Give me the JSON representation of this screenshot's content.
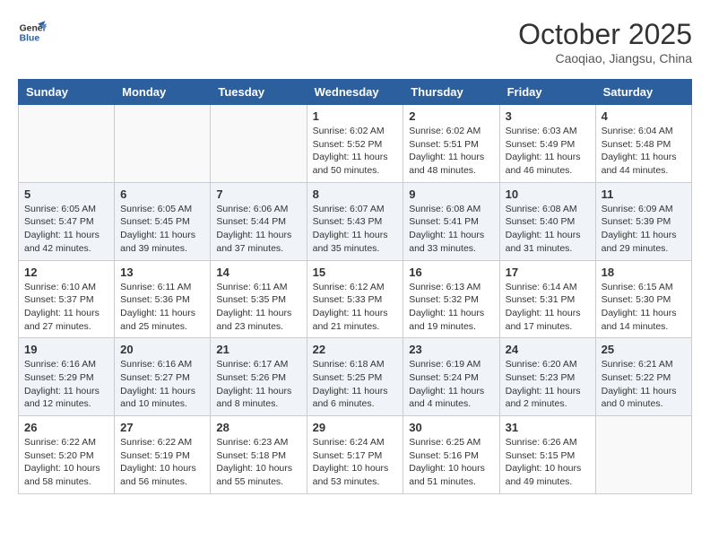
{
  "header": {
    "logo_line1": "General",
    "logo_line2": "Blue",
    "month": "October 2025",
    "location": "Caoqiao, Jiangsu, China"
  },
  "weekdays": [
    "Sunday",
    "Monday",
    "Tuesday",
    "Wednesday",
    "Thursday",
    "Friday",
    "Saturday"
  ],
  "weeks": [
    [
      {
        "day": "",
        "info": ""
      },
      {
        "day": "",
        "info": ""
      },
      {
        "day": "",
        "info": ""
      },
      {
        "day": "1",
        "info": "Sunrise: 6:02 AM\nSunset: 5:52 PM\nDaylight: 11 hours\nand 50 minutes."
      },
      {
        "day": "2",
        "info": "Sunrise: 6:02 AM\nSunset: 5:51 PM\nDaylight: 11 hours\nand 48 minutes."
      },
      {
        "day": "3",
        "info": "Sunrise: 6:03 AM\nSunset: 5:49 PM\nDaylight: 11 hours\nand 46 minutes."
      },
      {
        "day": "4",
        "info": "Sunrise: 6:04 AM\nSunset: 5:48 PM\nDaylight: 11 hours\nand 44 minutes."
      }
    ],
    [
      {
        "day": "5",
        "info": "Sunrise: 6:05 AM\nSunset: 5:47 PM\nDaylight: 11 hours\nand 42 minutes."
      },
      {
        "day": "6",
        "info": "Sunrise: 6:05 AM\nSunset: 5:45 PM\nDaylight: 11 hours\nand 39 minutes."
      },
      {
        "day": "7",
        "info": "Sunrise: 6:06 AM\nSunset: 5:44 PM\nDaylight: 11 hours\nand 37 minutes."
      },
      {
        "day": "8",
        "info": "Sunrise: 6:07 AM\nSunset: 5:43 PM\nDaylight: 11 hours\nand 35 minutes."
      },
      {
        "day": "9",
        "info": "Sunrise: 6:08 AM\nSunset: 5:41 PM\nDaylight: 11 hours\nand 33 minutes."
      },
      {
        "day": "10",
        "info": "Sunrise: 6:08 AM\nSunset: 5:40 PM\nDaylight: 11 hours\nand 31 minutes."
      },
      {
        "day": "11",
        "info": "Sunrise: 6:09 AM\nSunset: 5:39 PM\nDaylight: 11 hours\nand 29 minutes."
      }
    ],
    [
      {
        "day": "12",
        "info": "Sunrise: 6:10 AM\nSunset: 5:37 PM\nDaylight: 11 hours\nand 27 minutes."
      },
      {
        "day": "13",
        "info": "Sunrise: 6:11 AM\nSunset: 5:36 PM\nDaylight: 11 hours\nand 25 minutes."
      },
      {
        "day": "14",
        "info": "Sunrise: 6:11 AM\nSunset: 5:35 PM\nDaylight: 11 hours\nand 23 minutes."
      },
      {
        "day": "15",
        "info": "Sunrise: 6:12 AM\nSunset: 5:33 PM\nDaylight: 11 hours\nand 21 minutes."
      },
      {
        "day": "16",
        "info": "Sunrise: 6:13 AM\nSunset: 5:32 PM\nDaylight: 11 hours\nand 19 minutes."
      },
      {
        "day": "17",
        "info": "Sunrise: 6:14 AM\nSunset: 5:31 PM\nDaylight: 11 hours\nand 17 minutes."
      },
      {
        "day": "18",
        "info": "Sunrise: 6:15 AM\nSunset: 5:30 PM\nDaylight: 11 hours\nand 14 minutes."
      }
    ],
    [
      {
        "day": "19",
        "info": "Sunrise: 6:16 AM\nSunset: 5:29 PM\nDaylight: 11 hours\nand 12 minutes."
      },
      {
        "day": "20",
        "info": "Sunrise: 6:16 AM\nSunset: 5:27 PM\nDaylight: 11 hours\nand 10 minutes."
      },
      {
        "day": "21",
        "info": "Sunrise: 6:17 AM\nSunset: 5:26 PM\nDaylight: 11 hours\nand 8 minutes."
      },
      {
        "day": "22",
        "info": "Sunrise: 6:18 AM\nSunset: 5:25 PM\nDaylight: 11 hours\nand 6 minutes."
      },
      {
        "day": "23",
        "info": "Sunrise: 6:19 AM\nSunset: 5:24 PM\nDaylight: 11 hours\nand 4 minutes."
      },
      {
        "day": "24",
        "info": "Sunrise: 6:20 AM\nSunset: 5:23 PM\nDaylight: 11 hours\nand 2 minutes."
      },
      {
        "day": "25",
        "info": "Sunrise: 6:21 AM\nSunset: 5:22 PM\nDaylight: 11 hours\nand 0 minutes."
      }
    ],
    [
      {
        "day": "26",
        "info": "Sunrise: 6:22 AM\nSunset: 5:20 PM\nDaylight: 10 hours\nand 58 minutes."
      },
      {
        "day": "27",
        "info": "Sunrise: 6:22 AM\nSunset: 5:19 PM\nDaylight: 10 hours\nand 56 minutes."
      },
      {
        "day": "28",
        "info": "Sunrise: 6:23 AM\nSunset: 5:18 PM\nDaylight: 10 hours\nand 55 minutes."
      },
      {
        "day": "29",
        "info": "Sunrise: 6:24 AM\nSunset: 5:17 PM\nDaylight: 10 hours\nand 53 minutes."
      },
      {
        "day": "30",
        "info": "Sunrise: 6:25 AM\nSunset: 5:16 PM\nDaylight: 10 hours\nand 51 minutes."
      },
      {
        "day": "31",
        "info": "Sunrise: 6:26 AM\nSunset: 5:15 PM\nDaylight: 10 hours\nand 49 minutes."
      },
      {
        "day": "",
        "info": ""
      }
    ]
  ]
}
